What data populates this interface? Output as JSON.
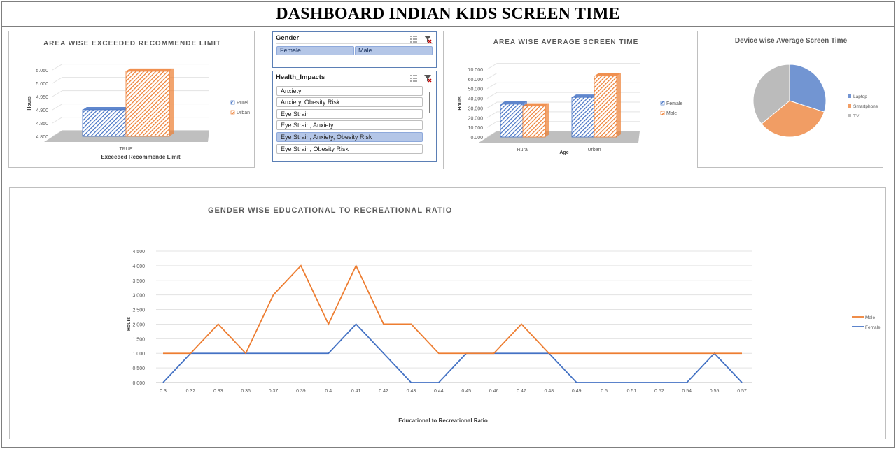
{
  "dashboard": {
    "title": "DASHBOARD INDIAN KIDS SCREEN TIME"
  },
  "colors": {
    "blue": "#4472c4",
    "orange": "#ed7d31",
    "gray": "#a5a5a5",
    "slicer_border": "#5b7fb5",
    "chip_fill": "#b4c6e7"
  },
  "slicers": {
    "gender": {
      "title": "Gender",
      "items": [
        "Female",
        "Male"
      ],
      "selected": [
        "Female",
        "Male"
      ]
    },
    "health": {
      "title": "Health_Impacts",
      "items": [
        "Anxiety",
        "Anxiety, Obesity Risk",
        "Eye Strain",
        "Eye Strain, Anxiety",
        "Eye Strain, Anxiety, Obesity Risk",
        "Eye Strain, Obesity Risk"
      ],
      "selected": "Eye Strain, Anxiety, Obesity Risk"
    },
    "icons": [
      "multi-select-icon",
      "clear-filter-icon"
    ]
  },
  "chart_data": [
    {
      "type": "bar",
      "title": "AREA WISE EXCEEDED RECOMMENDE LIMIT",
      "categories": [
        "TRUE"
      ],
      "series": [
        {
          "name": "Rurel",
          "values": [
            4.9
          ]
        },
        {
          "name": "Urban",
          "values": [
            5.045
          ]
        }
      ],
      "xlabel": "Exceeded Recommende Limit",
      "ylabel": "Hours",
      "ylim": [
        4.8,
        5.05
      ],
      "yticks": [
        "4.800",
        "4.850",
        "4.900",
        "4.950",
        "5.000",
        "5.050"
      ],
      "legend": "right",
      "grid": true,
      "style": "3d-hatched"
    },
    {
      "type": "bar",
      "title": "AREA WISE AVERAGE SCREEN TIME",
      "categories": [
        "Rural",
        "Urban"
      ],
      "series": [
        {
          "name": "Female",
          "values": [
            34000,
            41000
          ]
        },
        {
          "name": "Male",
          "values": [
            32000,
            63000
          ]
        }
      ],
      "xlabel": "Age",
      "ylabel": "Hours",
      "ylim": [
        0,
        70000
      ],
      "yticks": [
        "0.000",
        "10.000",
        "20.000",
        "30.000",
        "40.000",
        "50.000",
        "60.000",
        "70.000"
      ],
      "legend": "right",
      "grid": true,
      "style": "3d-hatched"
    },
    {
      "type": "pie",
      "title": "Device wise Average Screen Time",
      "categories": [
        "Laptop",
        "Smartphone",
        "TV"
      ],
      "values": [
        30,
        34,
        36
      ],
      "legend": "right"
    },
    {
      "type": "line",
      "title": "GENDER WISE EDUCATIONAL TO RECREATIONAL RATIO",
      "x": [
        "0.3",
        "0.32",
        "0.33",
        "0.36",
        "0.37",
        "0.39",
        "0.4",
        "0.41",
        "0.42",
        "0.43",
        "0.44",
        "0.45",
        "0.46",
        "0.47",
        "0.48",
        "0.49",
        "0.5",
        "0.51",
        "0.52",
        "0.54",
        "0.55",
        "0.57"
      ],
      "series": [
        {
          "name": "Male",
          "values": [
            1,
            1,
            2,
            1,
            3,
            4,
            2,
            4,
            2,
            2,
            1,
            1,
            1,
            2,
            1,
            1,
            1,
            1,
            1,
            1,
            1,
            1
          ]
        },
        {
          "name": "Female",
          "values": [
            0,
            1,
            1,
            1,
            1,
            1,
            1,
            2,
            1,
            0,
            0,
            1,
            1,
            1,
            1,
            0,
            0,
            0,
            0,
            0,
            1,
            0
          ]
        }
      ],
      "xlabel": "Educational to Recreational Ratio",
      "ylabel": "Hours",
      "ylim": [
        0,
        4.5
      ],
      "yticks": [
        "0.000",
        "0.500",
        "1.000",
        "1.500",
        "2.000",
        "2.500",
        "3.000",
        "3.500",
        "4.000",
        "4.500"
      ],
      "legend": "right",
      "grid": true
    }
  ]
}
